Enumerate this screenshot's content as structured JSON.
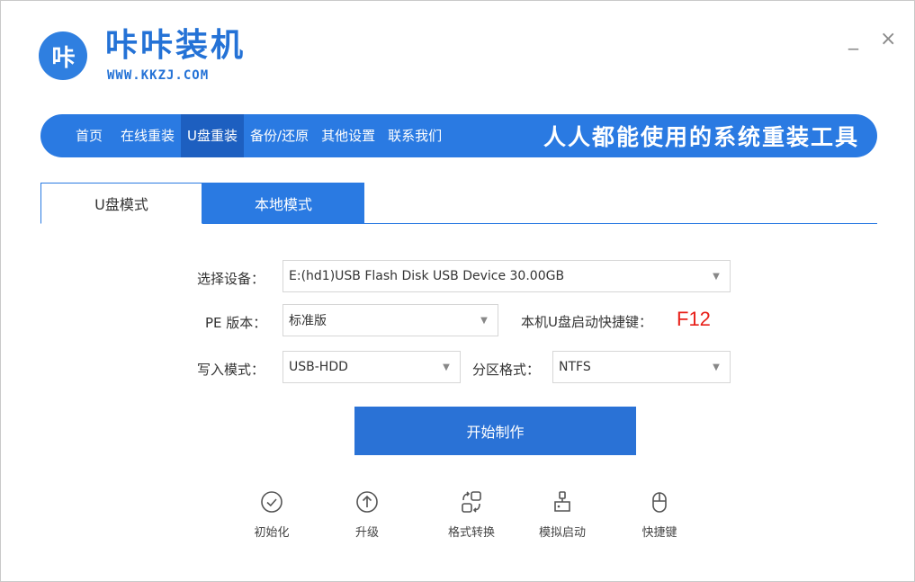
{
  "app": {
    "logo_text": "咔",
    "title": "咔咔装机",
    "url": "WWW.KKZJ.COM",
    "minimize": "_",
    "close": "×"
  },
  "nav": {
    "items": [
      "首页",
      "在线重装",
      "U盘重装",
      "备份/还原",
      "其他设置",
      "联系我们"
    ],
    "active_index": 2,
    "slogan": "人人都能使用的系统重装工具"
  },
  "tabs": [
    "U盘模式",
    "本地模式"
  ],
  "form": {
    "device_label": "选择设备：",
    "device_value": "E:(hd1)USB Flash Disk USB Device 30.00GB",
    "pe_label": "PE 版本：",
    "pe_value": "标准版",
    "hotkey_label": "本机U盘启动快捷键：",
    "hotkey_value": "F12",
    "write_label": "写入模式：",
    "write_value": "USB-HDD",
    "partition_label": "分区格式：",
    "partition_value": "NTFS"
  },
  "start_button": "开始制作",
  "tools": [
    {
      "label": "初始化",
      "icon": "check-circle-icon"
    },
    {
      "label": "升级",
      "icon": "upgrade-arrow-icon"
    },
    {
      "label": "格式转换",
      "icon": "convert-icon"
    },
    {
      "label": "模拟启动",
      "icon": "simulate-boot-icon"
    },
    {
      "label": "快捷键",
      "icon": "mouse-icon"
    }
  ],
  "colors": {
    "primary": "#2a7ae2",
    "hotkey": "#e8201a"
  }
}
